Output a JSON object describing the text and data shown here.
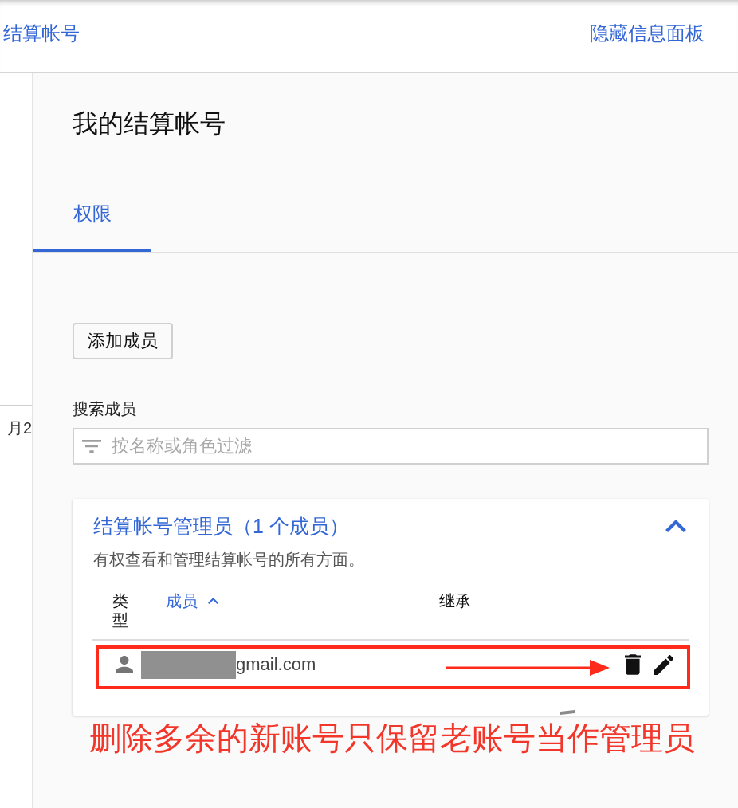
{
  "top_bar": {
    "title": "结算帐号",
    "panel_link": "隐藏信息面板"
  },
  "sidebar": {
    "cut_text": "月2"
  },
  "page": {
    "title": "我的结算帐号",
    "tabs": [
      {
        "label": "权限",
        "selected": true
      }
    ]
  },
  "add_member_button": "添加成员",
  "search": {
    "label": "搜索成员",
    "placeholder": "按名称或角色过滤"
  },
  "role_card": {
    "title": "结算帐号管理员（1 个成员）",
    "description": "有权查看和管理结算帐号的所有方面。",
    "expanded": true,
    "columns": [
      {
        "label": "类型",
        "sorted": false
      },
      {
        "label": "成员",
        "sorted": true
      },
      {
        "label": "继承",
        "sorted": false
      }
    ],
    "rows": [
      {
        "kind": "user",
        "member": "gmail.com",
        "redacted": true,
        "highlighted": true
      }
    ]
  },
  "annotation": {
    "text": "删除多余的新账号只保留老账号当作管理员"
  }
}
